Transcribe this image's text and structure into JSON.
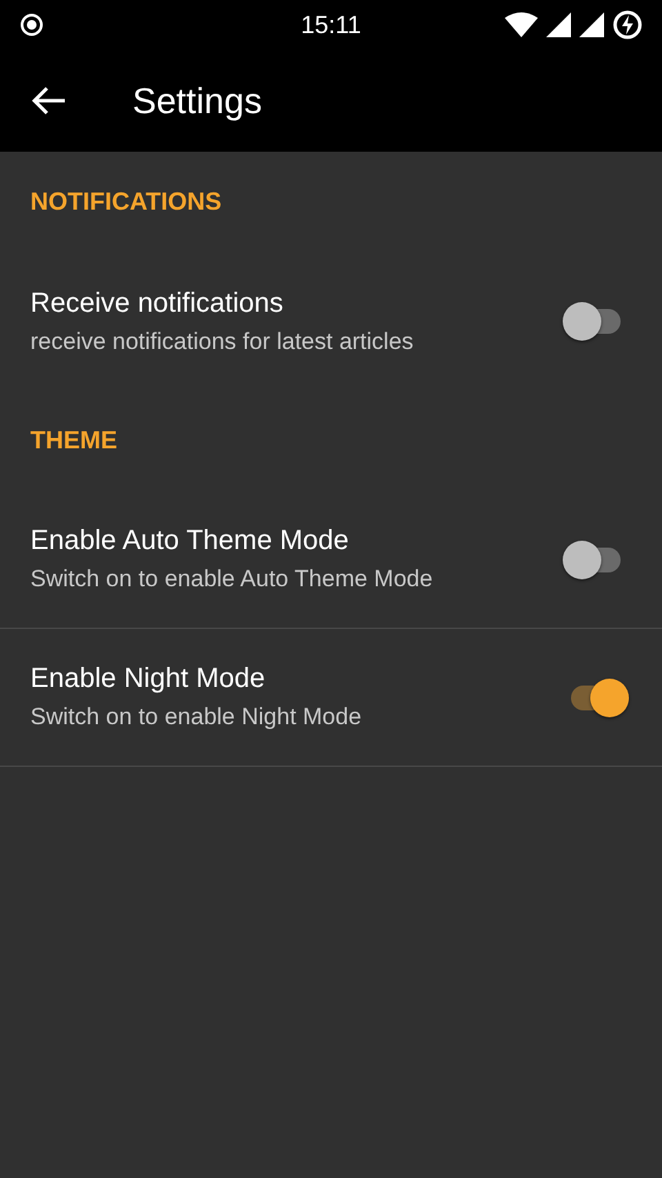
{
  "status_bar": {
    "time": "15:11"
  },
  "toolbar": {
    "title": "Settings"
  },
  "sections": [
    {
      "header": "NOTIFICATIONS",
      "items": [
        {
          "title": "Receive notifications",
          "summary": "receive notifications for latest articles",
          "on": false
        }
      ]
    },
    {
      "header": "THEME",
      "items": [
        {
          "title": "Enable Auto Theme Mode",
          "summary": "Switch on to enable Auto Theme Mode",
          "on": false
        },
        {
          "title": "Enable Night Mode",
          "summary": "Switch on to enable Night Mode",
          "on": true
        }
      ]
    }
  ]
}
